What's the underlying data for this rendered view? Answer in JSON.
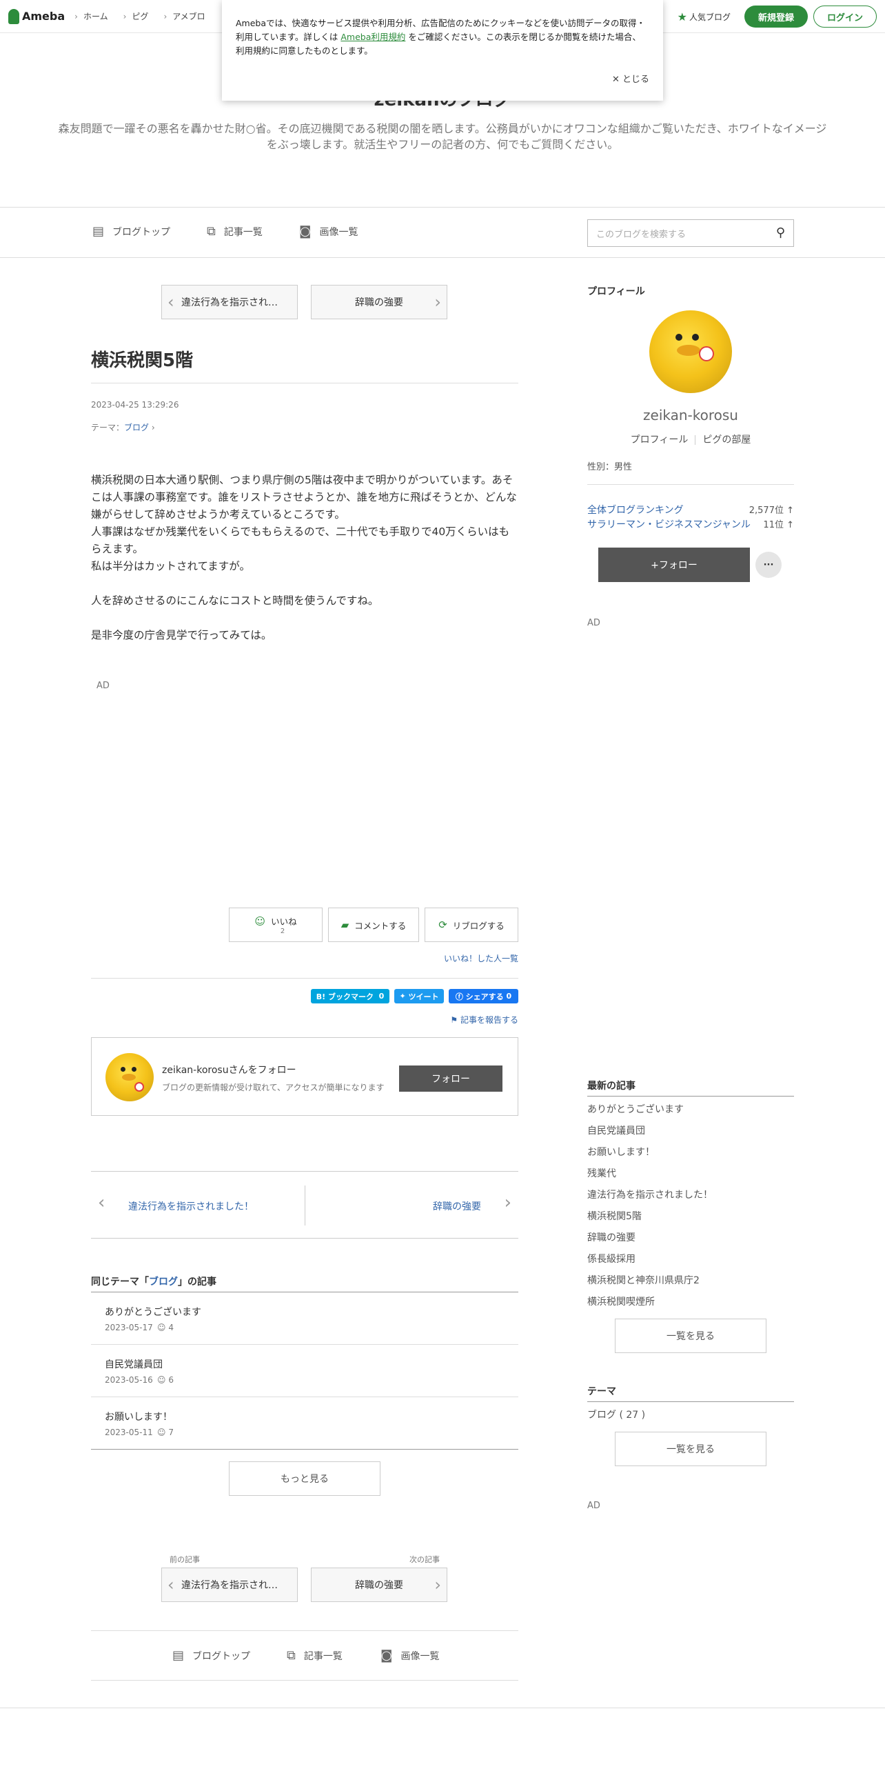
{
  "topbar": {
    "logo": "Ameba",
    "breadcrumbs": [
      "ホーム",
      "ピグ",
      "アメブロ"
    ],
    "popular": "人気ブログ",
    "register": "新規登録",
    "login": "ログイン"
  },
  "cookie": {
    "text_before": "Amebaでは、快適なサービス提供や利用分析、広告配信のためにクッキーなどを使い訪問データの取得・利用しています。詳しくは",
    "link": "Ameba利用規約",
    "text_after": "をご確認ください。この表示を閉じるか閲覧を続けた場合、利用規約に同意したものとします。",
    "close": "✕ とじる"
  },
  "header": {
    "title": "zeikanのブログ",
    "description": "森友問題で一躍その悪名を轟かせた財○省。その底辺機関である税関の闇を晒します。公務員がいかにオワコンな組織かご覧いただき、ホワイトなイメージをぶっ壊します。就活生やフリーの記者の方、何でもご質問ください。"
  },
  "nav": {
    "top": "ブログトップ",
    "list": "記事一覧",
    "images": "画像一覧",
    "search_placeholder": "このブログを検索する"
  },
  "pager": {
    "prev": "違法行為を指示され…",
    "next": "辞職の強要",
    "prev_label": "前の記事",
    "next_label": "次の記事"
  },
  "article": {
    "title": "横浜税関5階",
    "date": "2023-04-25 13:29:26",
    "theme_label": "テーマ：",
    "theme": "ブログ",
    "paragraphs": [
      "横浜税関の日本大通り駅側、つまり県庁側の5階は夜中まで明かりがついています。あそこは人事課の事務室です。誰をリストラさせようとか、誰を地方に飛ばそうとか、どんな嫌がらせして辞めさせようか考えているところです。",
      "人事課はなぜか残業代をいくらでももらえるので、二十代でも手取りで40万くらいはもらえます。",
      "私は半分はカットされてますが。",
      "人を辞めさせるのにこんなにコストと時間を使うんですね。",
      "是非今度の庁舎見学で行ってみては。"
    ],
    "ad": "AD"
  },
  "actions": {
    "like": "いいね",
    "like_count": "2",
    "comment": "コメントする",
    "reblog": "リブログする",
    "liked_list": "いいね！した人一覧",
    "hatena": "B! ブックマーク",
    "hatena_count": "0",
    "tweet": "ツイート",
    "fb": "シェアする",
    "fb_count": "0",
    "report": "記事を報告する"
  },
  "follow": {
    "name": "zeikan-korosuさんをフォロー",
    "sub": "ブログの更新情報が受け取れて、アクセスが簡単になります",
    "button": "フォロー"
  },
  "prevnext": {
    "prev": "違法行為を指示されました！",
    "next": "辞職の強要"
  },
  "same_theme": {
    "head_before": "同じテーマ「",
    "theme": "ブログ",
    "head_after": "」の記事",
    "items": [
      {
        "title": "ありがとうございます",
        "date": "2023-05-17",
        "likes": "4"
      },
      {
        "title": "自民党議員団",
        "date": "2023-05-16",
        "likes": "6"
      },
      {
        "title": "お願いします！",
        "date": "2023-05-11",
        "likes": "7"
      }
    ],
    "more": "もっと見る"
  },
  "sidebar": {
    "profile_head": "プロフィール",
    "name": "zeikan-korosu",
    "profile_link": "プロフィール",
    "pig_link": "ピグの部屋",
    "gender": "性別：男性",
    "rankings": [
      {
        "name": "全体ブログランキング",
        "value": "2,577位 ↑"
      },
      {
        "name": "サラリーマン・ビジネスマンジャンル",
        "value": "11位 ↑"
      }
    ],
    "follow": "+フォロー",
    "more": "···",
    "ad": "AD",
    "recent_head": "最新の記事",
    "recent": [
      "ありがとうございます",
      "自民党議員団",
      "お願いします！",
      "残業代",
      "違法行為を指示されました！",
      "横浜税関5階",
      "辞職の強要",
      "係長級採用",
      "横浜税関と神奈川県県庁2",
      "横浜税関喫煙所"
    ],
    "recent_more": "一覧を見る",
    "theme_head": "テーマ",
    "theme_item": "ブログ ( 27 )",
    "theme_more": "一覧を見る",
    "ad2": "AD"
  },
  "colors": {
    "accent": "#2d8c3c",
    "link": "#3366aa",
    "hatena": "#00a4de",
    "twitter": "#1d9bf0",
    "facebook": "#1877f2"
  }
}
